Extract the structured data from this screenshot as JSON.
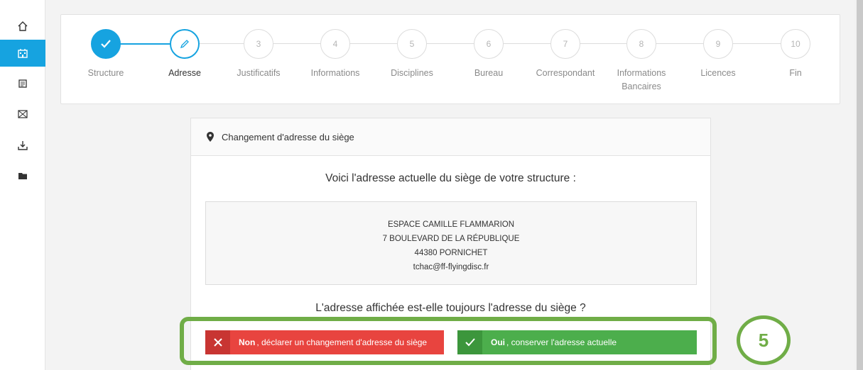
{
  "colors": {
    "accent": "#16a3e0",
    "danger": "#e8443f",
    "success": "#4cae4c",
    "annotation": "#70ad47"
  },
  "sidebar": {
    "items": [
      {
        "icon": "home-icon",
        "active": false
      },
      {
        "icon": "building-icon",
        "active": true
      },
      {
        "icon": "documents-icon",
        "active": false
      },
      {
        "icon": "checkered-flag-icon",
        "active": false
      },
      {
        "icon": "download-tray-icon",
        "active": false
      },
      {
        "icon": "folder-icon",
        "active": false
      }
    ]
  },
  "stepper": {
    "steps": [
      {
        "number": "",
        "label": "Structure",
        "state": "done"
      },
      {
        "number": "",
        "label": "Adresse",
        "state": "current"
      },
      {
        "number": "3",
        "label": "Justificatifs",
        "state": "todo"
      },
      {
        "number": "4",
        "label": "Informations",
        "state": "todo"
      },
      {
        "number": "5",
        "label": "Disciplines",
        "state": "todo"
      },
      {
        "number": "6",
        "label": "Bureau",
        "state": "todo"
      },
      {
        "number": "7",
        "label": "Correspondant",
        "state": "todo"
      },
      {
        "number": "8",
        "label": "Informations",
        "label2": "Bancaires",
        "state": "todo"
      },
      {
        "number": "9",
        "label": "Licences",
        "state": "todo"
      },
      {
        "number": "10",
        "label": "Fin",
        "state": "todo"
      }
    ]
  },
  "panel": {
    "title": "Changement d'adresse du siège",
    "intro": "Voici l'adresse actuelle du siège de votre structure :",
    "address": {
      "line1": "ESPACE CAMILLE FLAMMARION",
      "line2": "7 BOULEVARD DE LA RÉPUBLIQUE",
      "line3": "44380 PORNICHET",
      "email": "tchac@ff-flyingdisc.fr"
    },
    "question": "L'adresse affichée est-elle toujours l'adresse du siège ?",
    "no_button": {
      "bold": "Non",
      "rest": ", déclarer un changement d'adresse du siège"
    },
    "yes_button": {
      "bold": "Oui",
      "rest": ", conserver l'adresse actuelle"
    }
  },
  "annotation": {
    "badge": "5"
  }
}
